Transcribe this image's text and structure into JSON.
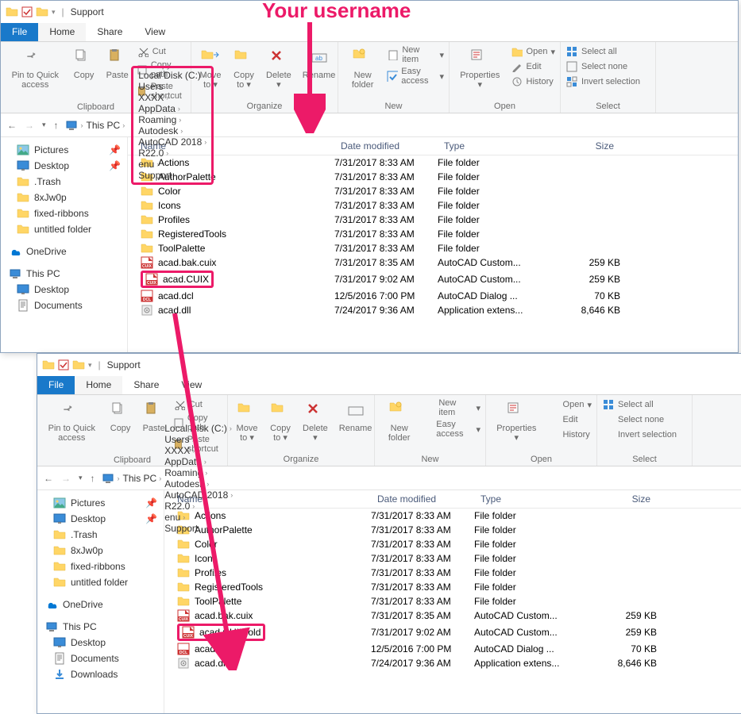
{
  "annotation": {
    "label": "Your username"
  },
  "window": {
    "title": "Support",
    "tabs": {
      "file": "File",
      "home": "Home",
      "share": "Share",
      "view": "View"
    },
    "ribbon": {
      "clipboard": {
        "label": "Clipboard",
        "pin": "Pin to Quick access",
        "copy": "Copy",
        "paste": "Paste",
        "cut": "Cut",
        "copypath": "Copy path",
        "pasteshortcut": "Paste shortcut"
      },
      "organize": {
        "label": "Organize",
        "moveto": "Move to",
        "copyto": "Copy to",
        "delete": "Delete",
        "rename": "Rename"
      },
      "new": {
        "label": "New",
        "newfolder": "New folder",
        "newitem": "New item",
        "easyaccess": "Easy access"
      },
      "open": {
        "label": "Open",
        "properties": "Properties",
        "open": "Open",
        "edit": "Edit",
        "history": "History"
      },
      "select": {
        "label": "Select",
        "all": "Select all",
        "none": "Select none",
        "invert": "Invert selection"
      }
    },
    "breadcrumb": {
      "thispc": "This PC",
      "segs": [
        "Local Disk (C:)",
        "Users",
        "XXXX",
        "AppData",
        "Roaming",
        "Autodesk",
        "AutoCAD 2018",
        "R22.0",
        "enu",
        "Support"
      ]
    },
    "sidebar": {
      "pictures": "Pictures",
      "desktop": "Desktop",
      "trash": ".Trash",
      "rand": "8xJw0p",
      "fixed": "fixed-ribbons",
      "untitled": "untitled folder",
      "onedrive": "OneDrive",
      "thispc": "This PC",
      "desktop2": "Desktop",
      "documents": "Documents",
      "downloads": "Downloads"
    },
    "columns": {
      "name": "Name",
      "date": "Date modified",
      "type": "Type",
      "size": "Size"
    },
    "files1": [
      {
        "name": "Actions",
        "date": "7/31/2017 8:33 AM",
        "type": "File folder",
        "size": "",
        "icon": "folder"
      },
      {
        "name": "AuthorPalette",
        "date": "7/31/2017 8:33 AM",
        "type": "File folder",
        "size": "",
        "icon": "folder"
      },
      {
        "name": "Color",
        "date": "7/31/2017 8:33 AM",
        "type": "File folder",
        "size": "",
        "icon": "folder"
      },
      {
        "name": "Icons",
        "date": "7/31/2017 8:33 AM",
        "type": "File folder",
        "size": "",
        "icon": "folder"
      },
      {
        "name": "Profiles",
        "date": "7/31/2017 8:33 AM",
        "type": "File folder",
        "size": "",
        "icon": "folder"
      },
      {
        "name": "RegisteredTools",
        "date": "7/31/2017 8:33 AM",
        "type": "File folder",
        "size": "",
        "icon": "folder"
      },
      {
        "name": "ToolPalette",
        "date": "7/31/2017 8:33 AM",
        "type": "File folder",
        "size": "",
        "icon": "folder"
      },
      {
        "name": "acad.bak.cuix",
        "date": "7/31/2017 8:35 AM",
        "type": "AutoCAD Custom...",
        "size": "259 KB",
        "icon": "cuix"
      },
      {
        "name": "acad.CUIX",
        "date": "7/31/2017 9:02 AM",
        "type": "AutoCAD Custom...",
        "size": "259 KB",
        "icon": "cuix",
        "hilite": true
      },
      {
        "name": "acad.dcl",
        "date": "12/5/2016 7:00 PM",
        "type": "AutoCAD Dialog ...",
        "size": "70 KB",
        "icon": "dcl"
      },
      {
        "name": "acad.dll",
        "date": "7/24/2017 9:36 AM",
        "type": "Application extens...",
        "size": "8,646 KB",
        "icon": "dll"
      }
    ],
    "files2": [
      {
        "name": "Actions",
        "date": "7/31/2017 8:33 AM",
        "type": "File folder",
        "size": "",
        "icon": "folder"
      },
      {
        "name": "AuthorPalette",
        "date": "7/31/2017 8:33 AM",
        "type": "File folder",
        "size": "",
        "icon": "folder"
      },
      {
        "name": "Color",
        "date": "7/31/2017 8:33 AM",
        "type": "File folder",
        "size": "",
        "icon": "folder"
      },
      {
        "name": "Icons",
        "date": "7/31/2017 8:33 AM",
        "type": "File folder",
        "size": "",
        "icon": "folder"
      },
      {
        "name": "Profiles",
        "date": "7/31/2017 8:33 AM",
        "type": "File folder",
        "size": "",
        "icon": "folder"
      },
      {
        "name": "RegisteredTools",
        "date": "7/31/2017 8:33 AM",
        "type": "File folder",
        "size": "",
        "icon": "folder"
      },
      {
        "name": "ToolPalette",
        "date": "7/31/2017 8:33 AM",
        "type": "File folder",
        "size": "",
        "icon": "folder"
      },
      {
        "name": "acad.bak.cuix",
        "date": "7/31/2017 8:35 AM",
        "type": "AutoCAD Custom...",
        "size": "259 KB",
        "icon": "cuix"
      },
      {
        "name": "acad.CUIX.old",
        "date": "7/31/2017 9:02 AM",
        "type": "AutoCAD Custom...",
        "size": "259 KB",
        "icon": "cuix",
        "hilite": true
      },
      {
        "name": "acad.dcl",
        "date": "12/5/2016 7:00 PM",
        "type": "AutoCAD Dialog ...",
        "size": "70 KB",
        "icon": "dcl"
      },
      {
        "name": "acad.dll",
        "date": "7/24/2017 9:36 AM",
        "type": "Application extens...",
        "size": "8,646 KB",
        "icon": "dll"
      }
    ]
  }
}
